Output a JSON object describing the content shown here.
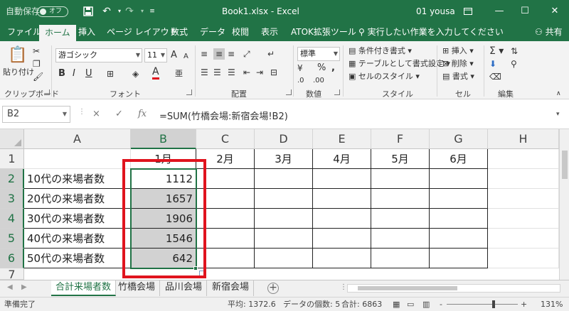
{
  "titlebar": {
    "autosave_label": "自動保存",
    "autosave_state": "オフ",
    "title": "Book1.xlsx - Excel",
    "user": "01 yousa",
    "icons": [
      "save-icon",
      "undo-icon",
      "redo-icon",
      "customize-icon",
      "ribbon-options-icon",
      "minimize-icon",
      "maximize-icon",
      "close-icon"
    ]
  },
  "ribbon_tabs": {
    "items": [
      "ファイル",
      "ホーム",
      "挿入",
      "ページ レイアウト",
      "数式",
      "データ",
      "校閲",
      "表示",
      "ATOK拡張ツール"
    ],
    "active": "ホーム",
    "tell_me": "実行したい作業を入力してください",
    "share": "共有"
  },
  "ribbon": {
    "clipboard": {
      "label": "クリップボード",
      "paste": "貼り付け"
    },
    "font": {
      "label": "フォント",
      "name": "游ゴシック",
      "size": "11",
      "bold": "B",
      "italic": "I",
      "underline": "U",
      "grow": "A",
      "shrink": "A",
      "font_color": "A",
      "phonetic": "亜"
    },
    "alignment": {
      "label": "配置"
    },
    "number": {
      "label": "数値",
      "format": "標準",
      "percent": "%",
      "comma": ","
    },
    "styles": {
      "label": "スタイル",
      "conditional": "条件付き書式",
      "table": "テーブルとして書式設定",
      "cell_styles": "セルのスタイル"
    },
    "cells": {
      "label": "セル",
      "insert": "挿入",
      "delete": "削除",
      "format": "書式"
    },
    "editing": {
      "label": "編集",
      "sum": "Σ"
    }
  },
  "formula_bar": {
    "name_box": "B2",
    "fx": "fx",
    "cancel": "×",
    "enter": "✓",
    "formula": "=SUM(竹橋会場:新宿会場!B2)"
  },
  "sheet": {
    "columns": [
      "A",
      "B",
      "C",
      "D",
      "E",
      "F",
      "G",
      "H"
    ],
    "rows": [
      "1",
      "2",
      "3",
      "4",
      "5",
      "6",
      "7"
    ],
    "header_row": [
      "",
      "1月",
      "2月",
      "3月",
      "4月",
      "5月",
      "6月"
    ],
    "data": [
      [
        "10代の来場者数",
        "1112"
      ],
      [
        "20代の来場者数",
        "1657"
      ],
      [
        "30代の来場者数",
        "1906"
      ],
      [
        "40代の来場者数",
        "1546"
      ],
      [
        "50代の来場者数",
        "642"
      ]
    ],
    "selected_column": "B",
    "selected_rows": [
      "2",
      "3",
      "4",
      "5",
      "6"
    ],
    "highlight_color": "#e0141e",
    "accent": "#217346"
  },
  "sheet_tabs": {
    "items": [
      "合計来場者数",
      "竹橋会場",
      "品川会場",
      "新宿会場"
    ],
    "active": "合計来場者数",
    "add": "+"
  },
  "status": {
    "ready": "準備完了",
    "average": "平均: 1372.6",
    "count": "データの個数: 5",
    "sum": "合計: 6863",
    "zoom_minus": "-",
    "zoom_plus": "+",
    "zoom": "131%"
  }
}
